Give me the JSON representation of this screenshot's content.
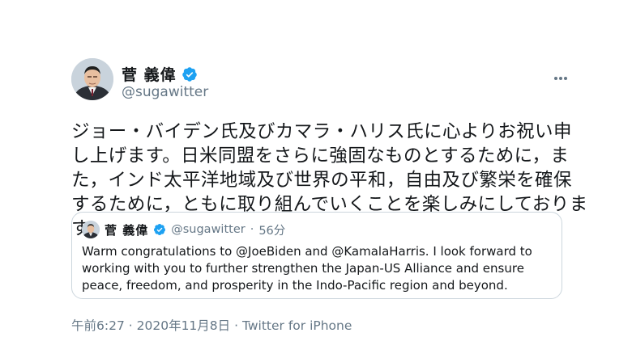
{
  "tweet": {
    "display_name": "菅 義偉",
    "handle": "@sugawitter",
    "verified_icon": "verified-badge-icon",
    "more_icon": "more-options-icon",
    "text": "ジョー・バイデン氏及びカマラ・ハリス氏に心よりお祝い申し上げます。日米同盟をさらに強固なものとするために，また，インド太平洋地域及び世界の平和，自由及び繁栄を確保するために，ともに取り組んでいくことを楽しみにしております。"
  },
  "quote": {
    "display_name": "菅 義偉",
    "handle": "@sugawitter",
    "separator": "·",
    "time": "56分",
    "text": "Warm congratulations to @JoeBiden and @KamalaHarris. I look forward to working with you to further strengthen the Japan-US Alliance and ensure peace, freedom, and prosperity in the Indo-Pacific region and beyond."
  },
  "footer": {
    "time": "午前6:27",
    "separator1": "·",
    "date": "2020年11月8日",
    "separator2": "·",
    "source": "Twitter for iPhone"
  },
  "colors": {
    "text": "#14171a",
    "secondary": "#657786",
    "verified": "#1da1f2",
    "border": "#ccd6dd"
  }
}
